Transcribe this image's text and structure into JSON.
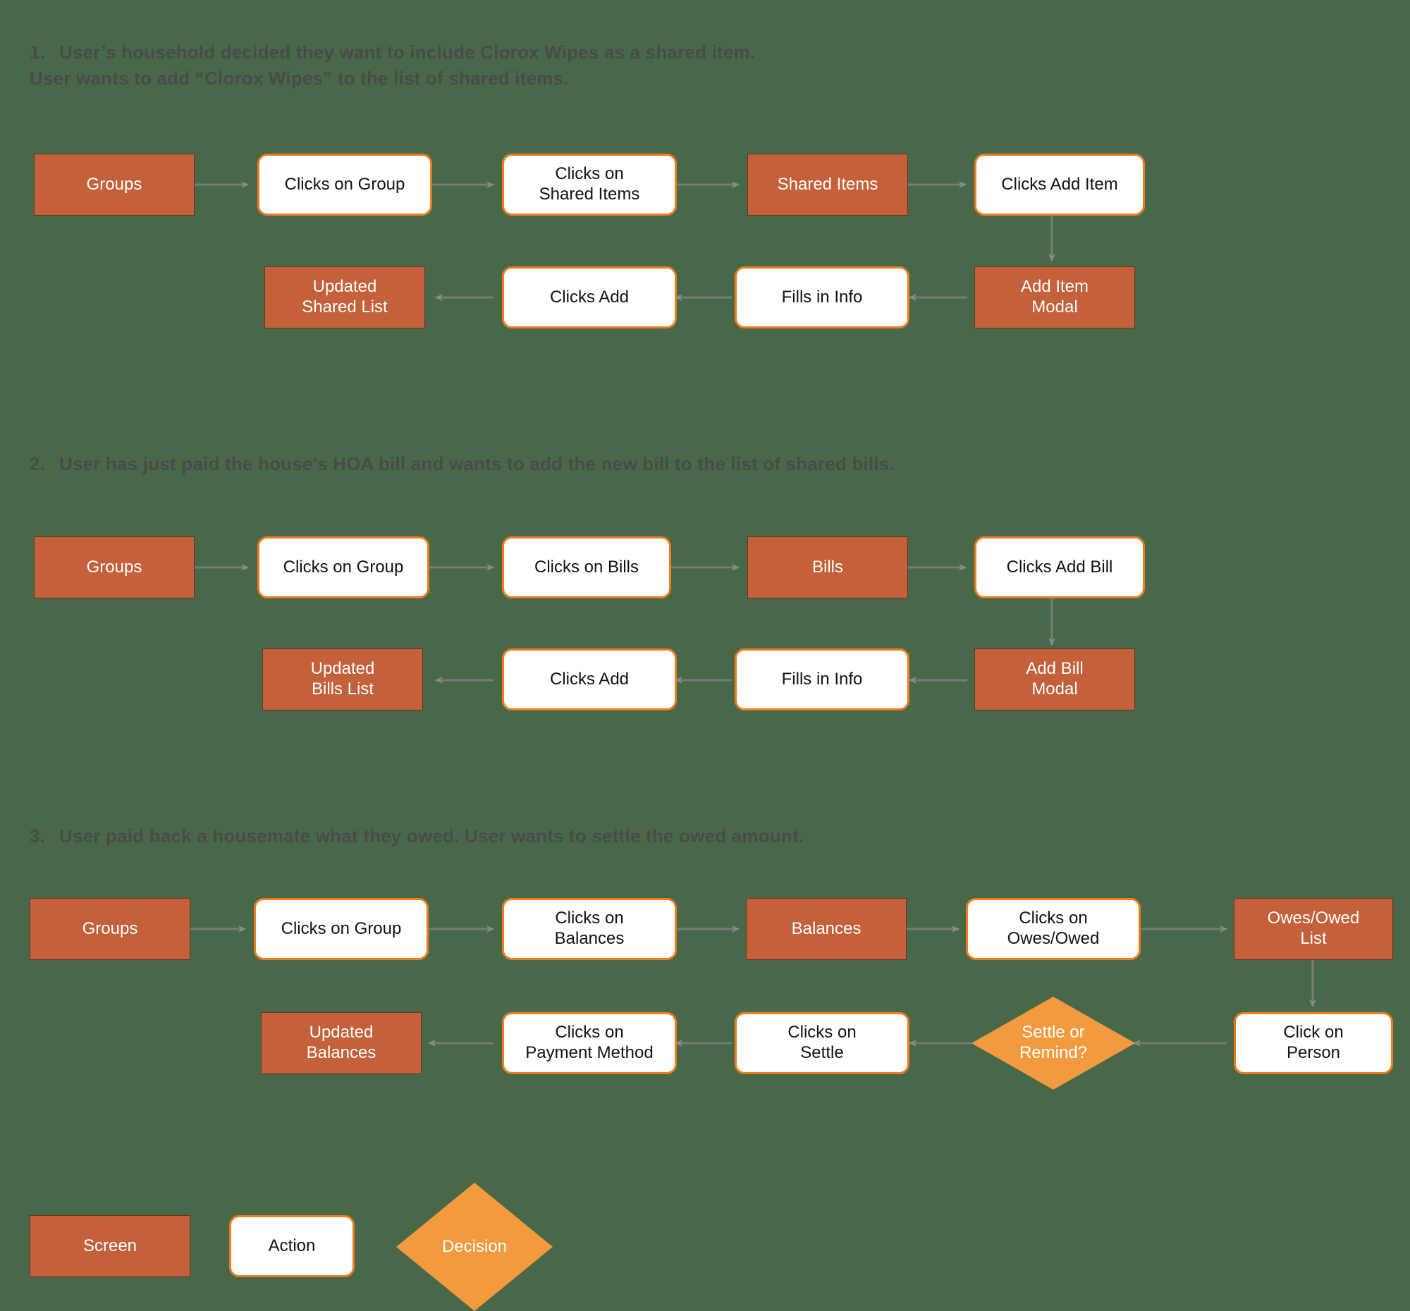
{
  "page": {
    "background_color": "#47694a",
    "screen_color": "#c4603a",
    "action_border_color": "#f07c1b",
    "action_fill_color": "#ffffff",
    "decision_color": "#f3993e",
    "heading_color": "#4a4a4a",
    "arrow_color": "#7a7a7a"
  },
  "sections": [
    {
      "number": "1.",
      "heading": "User’s household decided they want to include Clorox Wipes as a shared item.\nUser wants to add “Clorox Wipes” to the list of shared items.",
      "nodes": {
        "n1": "Groups",
        "n2": "Clicks on Group",
        "n3": "Clicks on\nShared Items",
        "n4": "Shared Items",
        "n5": "Clicks Add Item",
        "n6": "Add Item\nModal",
        "n7": "Fills in Info",
        "n8": "Clicks Add",
        "n9": "Updated\nShared List"
      }
    },
    {
      "number": "2.",
      "heading": "User has just paid the house’s HOA bill and wants to add the new bill to the list of shared bills.",
      "nodes": {
        "n1": "Groups",
        "n2": "Clicks on Group",
        "n3": "Clicks on Bills",
        "n4": "Bills",
        "n5": "Clicks Add Bill",
        "n6": "Add Bill\nModal",
        "n7": "Fills in Info",
        "n8": "Clicks Add",
        "n9": "Updated\nBills List"
      }
    },
    {
      "number": "3.",
      "heading": "User paid back a housemate what they owed. User wants to settle the owed amount.",
      "nodes": {
        "n1": "Groups",
        "n2": "Clicks on Group",
        "n3": "Clicks on\nBalances",
        "n4": "Balances",
        "n5": "Clicks on\nOwes/Owed",
        "n6": "Owes/Owed\nList",
        "n7": "Click on\nPerson",
        "n8": "Settle or\nRemind?",
        "n9": "Clicks on\nSettle",
        "n10": "Clicks on\nPayment Method",
        "n11": "Updated\nBalances"
      }
    }
  ],
  "legend": {
    "screen": "Screen",
    "action": "Action",
    "decision": "Decision"
  }
}
